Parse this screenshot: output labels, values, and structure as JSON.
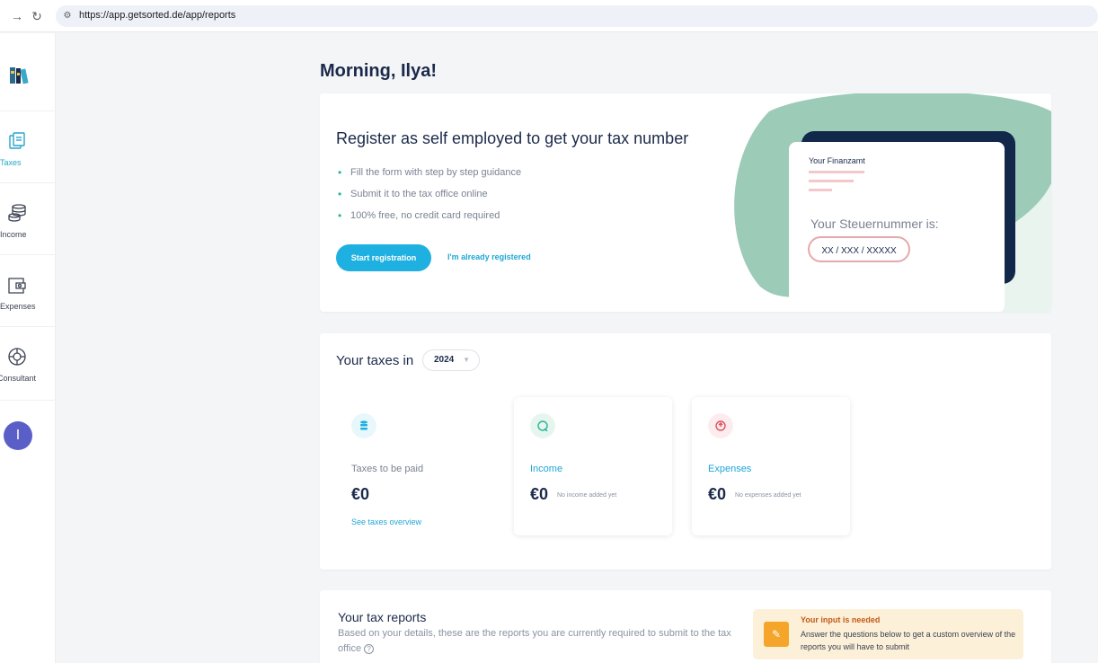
{
  "browser": {
    "url": "https://app.getsorted.de/app/reports"
  },
  "sidebar": {
    "items": [
      {
        "label": "Taxes",
        "icon": "taxes-icon",
        "active": true
      },
      {
        "label": "Income",
        "icon": "coins-icon",
        "active": false
      },
      {
        "label": "Expenses",
        "icon": "wallet-icon",
        "active": false
      },
      {
        "label": "Consultant",
        "icon": "lifebuoy-icon",
        "active": false
      }
    ],
    "avatar_initial": "I"
  },
  "greeting": "Morning, Ilya!",
  "registration": {
    "title": "Register as self employed to get your tax number",
    "bullets": [
      "Fill the form with step by step guidance",
      "Submit it to the tax office online",
      "100% free, no credit card required"
    ],
    "start_button": "Start registration",
    "already_link": "I'm already registered",
    "illustration": {
      "finanzamt_label": "Your Finanzamt",
      "steuernummer_label": "Your Steuernummer is:",
      "steuernummer_value": "XX / XXX / XXXXX"
    }
  },
  "taxes": {
    "title": "Your taxes in",
    "year": "2024",
    "stats": [
      {
        "name": "Taxes to be paid",
        "value": "€0",
        "note": "",
        "link": "See taxes overview"
      },
      {
        "name": "Income",
        "value": "€0",
        "note": "No income added yet",
        "link": ""
      },
      {
        "name": "Expenses",
        "value": "€0",
        "note": "No expenses added yet",
        "link": ""
      }
    ]
  },
  "reports": {
    "title": "Your tax reports",
    "description": "Based on your details, these are the reports you are currently required to submit to the tax office",
    "notice_title": "Your input is needed",
    "notice_text": "Answer the questions below to get a custom overview of the reports you will have to submit"
  },
  "colors": {
    "accent": "#1eb0e0",
    "brand_dark": "#1b2a4a",
    "illustration_green": "#9ccbb8",
    "notice_bg": "#fdf0d8"
  }
}
